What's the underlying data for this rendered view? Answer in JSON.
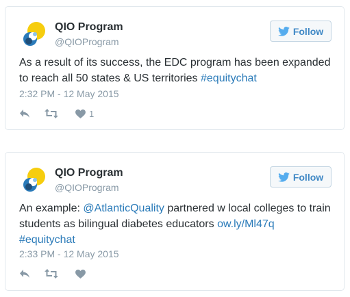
{
  "colors": {
    "link": "#2b7bb9",
    "follow_text": "#3f88c5",
    "muted": "#8899a6",
    "border": "#e1e8ed",
    "avatar_yellow": "#f6cd0e",
    "avatar_blue": "#2a7ab9",
    "avatar_navy": "#1f4e79"
  },
  "icons": {
    "follow": "twitter-bird-icon",
    "reply": "reply-icon",
    "retweet": "retweet-icon",
    "like": "heart-icon"
  },
  "tweets": [
    {
      "name": "QIO Program",
      "handle": "@QIOProgram",
      "follow_label": "Follow",
      "text_before": "As a result of its success, the EDC program has been expanded to reach all 50 states & US territories ",
      "hashtag": "#equitychat",
      "timestamp": "2:32 PM - 12 May 2015",
      "like_count": "1"
    },
    {
      "name": "QIO Program",
      "handle": "@QIOProgram",
      "follow_label": "Follow",
      "text_prefix": "An example: ",
      "mention": "@AtlanticQuality",
      "text_middle": " partnered w local colleges to train students as bilingual diabetes educators ",
      "url": "ow.ly/Ml47q",
      "hashtag": "#equitychat",
      "timestamp": "2:33 PM - 12 May 2015"
    }
  ]
}
